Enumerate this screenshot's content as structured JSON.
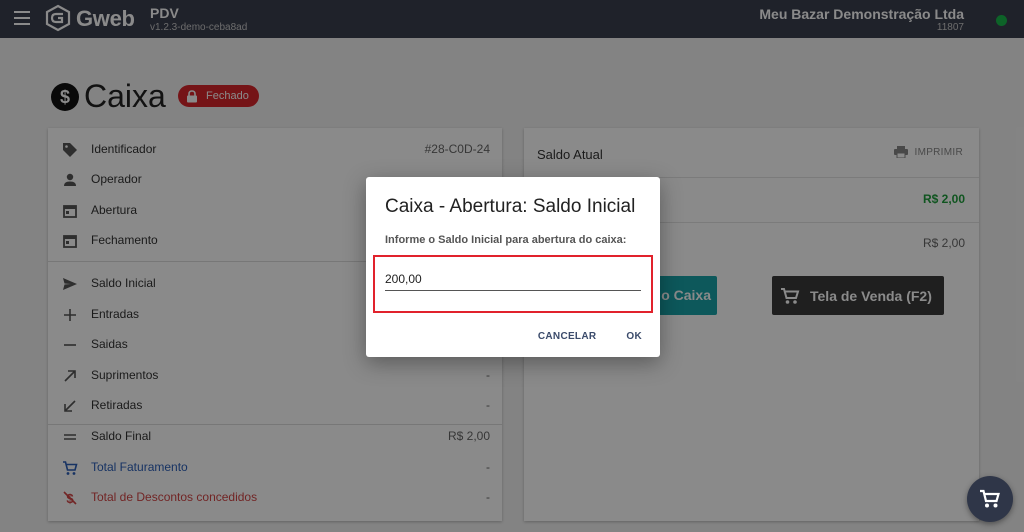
{
  "topbar": {
    "menu_icon": "menu-icon",
    "brand": "Gweb",
    "app_name": "PDV",
    "app_version": "v1.2.3-demo-ceba8ad",
    "store_name": "Meu Bazar Demonstração Ltda",
    "store_code": "11807",
    "status_color": "#18b84a"
  },
  "page": {
    "title": "Caixa",
    "status_badge": "Fechado",
    "status_badge_icon": "lock-icon",
    "status_badge_color": "#d9262c"
  },
  "left_card": {
    "info_rows": [
      {
        "icon": "tag-icon",
        "label": "Identificador",
        "value": "#28-C0D-24"
      },
      {
        "icon": "person-icon",
        "label": "Operador",
        "value": ""
      },
      {
        "icon": "calendar-icon",
        "label": "Abertura",
        "value": ""
      },
      {
        "icon": "calendar-icon",
        "label": "Fechamento",
        "value": ""
      }
    ],
    "money_rows": [
      {
        "icon": "send-icon",
        "label": "Saldo Inicial",
        "value": ""
      },
      {
        "icon": "plus-icon",
        "label": "Entradas",
        "value": ""
      },
      {
        "icon": "minus-icon",
        "label": "Saidas",
        "value": ""
      },
      {
        "icon": "arrow-up-right-icon",
        "label": "Suprimentos",
        "value": "-"
      },
      {
        "icon": "arrow-down-left-icon",
        "label": "Retiradas",
        "value": "-"
      }
    ],
    "total_rows": [
      {
        "icon": "equals-icon",
        "label": "Saldo Final",
        "value": "R$ 2,00"
      },
      {
        "icon": "cart-icon",
        "label": "Total Faturamento",
        "value": "-",
        "color": "#2b5eb8"
      },
      {
        "icon": "discount-icon",
        "label": "Total de Descontos concedidos",
        "value": "-",
        "color": "#d24545"
      }
    ]
  },
  "right_card": {
    "title": "Saldo Atual",
    "print_label": "IMPRIMIR",
    "print_icon": "printer-icon",
    "value_green": "R$ 2,00",
    "value_gray": "R$ 2,00",
    "abrir_button": "o Caixa",
    "venda_button": "Tela de Venda (F2)",
    "venda_icon": "cart-icon"
  },
  "fab": {
    "icon": "cart-icon"
  },
  "dialog": {
    "title": "Caixa - Abertura: Saldo Inicial",
    "subtitle": "Informe o Saldo Inicial para abertura do caixa:",
    "input_value": "200,00",
    "cancel_label": "CANCELAR",
    "ok_label": "OK",
    "highlight_color": "#e1222c"
  }
}
